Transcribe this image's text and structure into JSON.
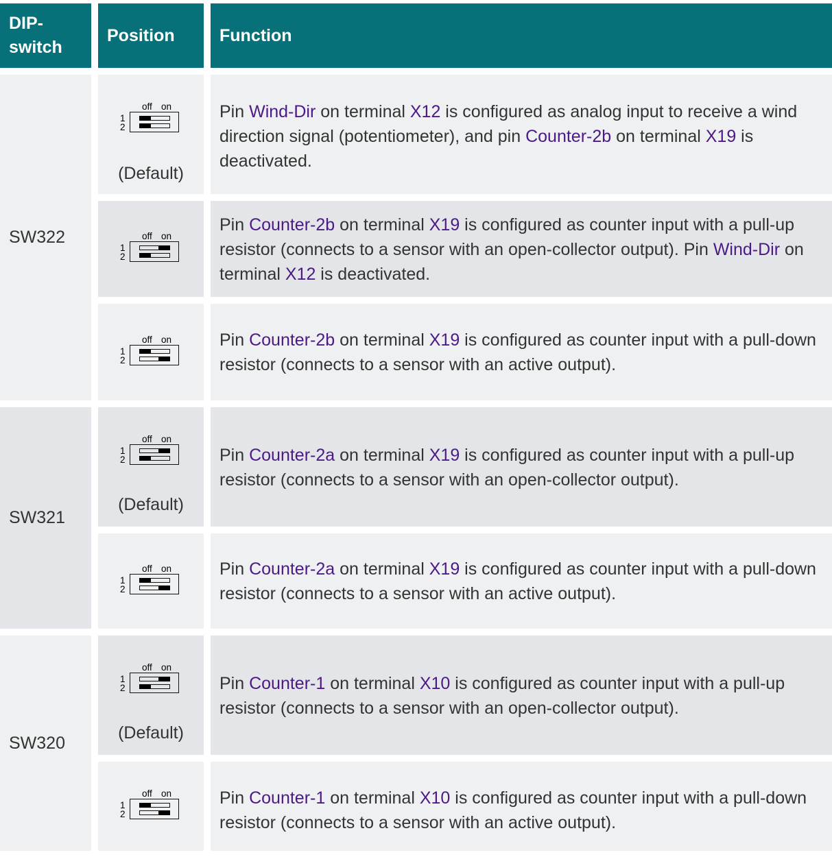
{
  "table": {
    "headers": {
      "dip": "DIP-switch",
      "position": "Position",
      "function": "Function"
    },
    "groups": [
      {
        "switch": "SW322",
        "rows": [
          {
            "pin1": "off",
            "pin2": "off",
            "default": "(Default)",
            "function": [
              {
                "t": "Pin "
              },
              {
                "t": "Wind-Dir",
                "link": true
              },
              {
                "t": " on terminal "
              },
              {
                "t": "X12",
                "link": true
              },
              {
                "t": " is configured as analog input to receive a wind direction signal (potentiometer), and pin "
              },
              {
                "t": "Counter-2b",
                "link": true
              },
              {
                "t": " on terminal "
              },
              {
                "t": "X19",
                "link": true
              },
              {
                "t": " is deactivated."
              }
            ]
          },
          {
            "pin1": "on",
            "pin2": "off",
            "default": "",
            "function": [
              {
                "t": "Pin "
              },
              {
                "t": "Counter-2b",
                "link": true
              },
              {
                "t": " on terminal "
              },
              {
                "t": "X19",
                "link": true
              },
              {
                "t": " is configured as counter input with a pull-up resistor (connects to a sensor with an open-collector output). Pin "
              },
              {
                "t": "Wind-Dir",
                "link": true
              },
              {
                "t": " on terminal "
              },
              {
                "t": "X12",
                "link": true
              },
              {
                "t": " is deactivated."
              }
            ]
          },
          {
            "pin1": "off",
            "pin2": "on",
            "default": "",
            "function": [
              {
                "t": "Pin "
              },
              {
                "t": "Counter-2b",
                "link": true
              },
              {
                "t": " on terminal "
              },
              {
                "t": "X19",
                "link": true
              },
              {
                "t": " is configured as counter input with a pull-down resistor (connects to a sensor with an active output)."
              }
            ]
          }
        ]
      },
      {
        "switch": "SW321",
        "rows": [
          {
            "pin1": "on",
            "pin2": "off",
            "default": "(Default)",
            "function": [
              {
                "t": "Pin "
              },
              {
                "t": "Counter-2a",
                "link": true
              },
              {
                "t": " on terminal "
              },
              {
                "t": "X19",
                "link": true
              },
              {
                "t": " is configured as counter input with a pull-up resistor (connects to a sensor with an open-collector output)."
              }
            ]
          },
          {
            "pin1": "off",
            "pin2": "on",
            "default": "",
            "function": [
              {
                "t": "Pin "
              },
              {
                "t": "Counter-2a",
                "link": true
              },
              {
                "t": " on terminal "
              },
              {
                "t": "X19",
                "link": true
              },
              {
                "t": " is configured as counter input with a pull-down resistor (connects to a sensor with an active output)."
              }
            ]
          }
        ]
      },
      {
        "switch": "SW320",
        "rows": [
          {
            "pin1": "on",
            "pin2": "off",
            "default": "(Default)",
            "function": [
              {
                "t": "Pin "
              },
              {
                "t": "Counter-1",
                "link": true
              },
              {
                "t": " on terminal "
              },
              {
                "t": "X10",
                "link": true
              },
              {
                "t": " is configured as counter input with a pull-up resistor (connects to a sensor with an open-collector output)."
              }
            ]
          },
          {
            "pin1": "off",
            "pin2": "on",
            "default": "",
            "function": [
              {
                "t": "Pin "
              },
              {
                "t": "Counter-1",
                "link": true
              },
              {
                "t": " on terminal "
              },
              {
                "t": "X10",
                "link": true
              },
              {
                "t": " is configured as counter input with a pull-down resistor (connects to a sensor with an active output)."
              }
            ]
          }
        ]
      }
    ],
    "symbol": {
      "off_label": "off",
      "on_label": "on",
      "pin1_label": "1",
      "pin2_label": "2"
    }
  },
  "colors": {
    "header_bg": "#087079",
    "header_text": "#ffffff",
    "row_dark": "#e3e5e8",
    "row_light": "#eef0f1",
    "text": "#333333",
    "link": "#4b1a86"
  }
}
